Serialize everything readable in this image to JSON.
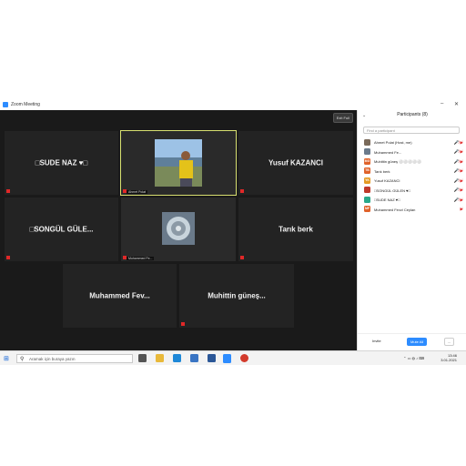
{
  "window": {
    "title": "Zoom Meeting"
  },
  "meeting": {
    "exit_fullscreen": "Exit Full",
    "tiles": [
      {
        "name": "□SUDE NAZ ♥□",
        "label": ""
      },
      {
        "name": "",
        "label": "Ahmet Polat"
      },
      {
        "name": "Yusuf KAZANCI",
        "label": ""
      },
      {
        "name": "□SONGÜL GÜLE...",
        "label": ""
      },
      {
        "name": "",
        "label": "Muhammed Fe..."
      },
      {
        "name": "Tarık berk",
        "label": ""
      },
      {
        "name": "Muhammed Fev...",
        "label": ""
      },
      {
        "name": "Muhittin güneş...",
        "label": ""
      }
    ]
  },
  "participants": {
    "title": "Participants (8)",
    "search_placeholder": "Find a participant",
    "list": [
      {
        "initials": "",
        "name": "Ahmet Polat (Host, me)",
        "color": "#7a6a5a"
      },
      {
        "initials": "",
        "name": "Muhammed Fe...",
        "color": "#6b7b8c"
      },
      {
        "initials": "MG",
        "name": "Muhittin güneş ⚪⚪⚪⚪⚪",
        "color": "#e0622a"
      },
      {
        "initials": "TB",
        "name": "Tarık berk",
        "color": "#e0622a"
      },
      {
        "initials": "YK",
        "name": "Yusuf KAZANCI",
        "color": "#e59b24"
      },
      {
        "initials": "",
        "name": "□SONGÜL GÜLEN ♥□",
        "color": "#c0392b"
      },
      {
        "initials": "",
        "name": "□SUDE NAZ ♥□",
        "color": "#2aa88a"
      },
      {
        "initials": "MF",
        "name": "Muhammed Fevzi Ceylan",
        "color": "#e0622a"
      }
    ],
    "invite": "Invite",
    "mute_all": "Mute All",
    "more": "..."
  },
  "taskbar": {
    "search_placeholder": "Aramak için buraya yazın",
    "time": "13:46",
    "date": "3.01.2021",
    "apps": [
      {
        "icon": "task-view-icon",
        "color": "#555555"
      },
      {
        "icon": "file-explorer-icon",
        "color": "#e9b93a"
      },
      {
        "icon": "edge-icon",
        "color": "#1e88d8"
      },
      {
        "icon": "store-icon",
        "color": "#3a75c4"
      },
      {
        "icon": "mail-icon",
        "color": "#2b5797"
      },
      {
        "icon": "zoom-icon",
        "color": "#2d8cff"
      },
      {
        "icon": "chrome-icon",
        "color": "#d33b2c"
      }
    ]
  }
}
